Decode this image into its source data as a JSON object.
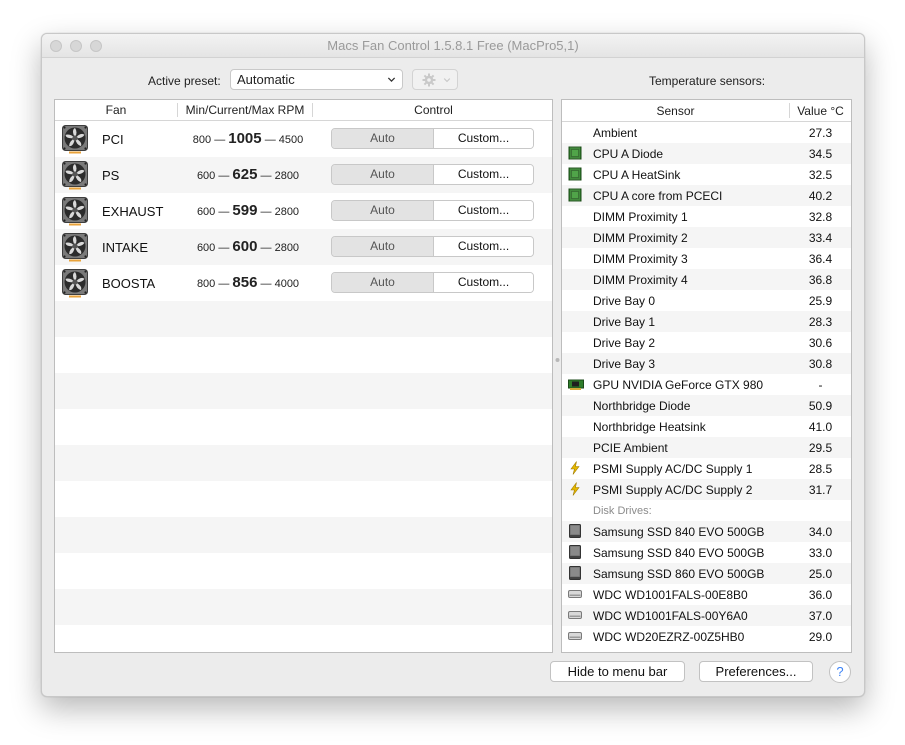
{
  "window": {
    "title": "Macs Fan Control 1.5.8.1 Free (MacPro5,1)"
  },
  "preset": {
    "label": "Active preset:",
    "value": "Automatic"
  },
  "temperature_title": "Temperature sensors:",
  "fan_table": {
    "headers": [
      "Fan",
      "Min/Current/Max RPM",
      "Control"
    ],
    "rows": [
      {
        "name": "PCI",
        "min": "800",
        "current": "1005",
        "max": "4500",
        "auto": "Auto",
        "custom": "Custom..."
      },
      {
        "name": "PS",
        "min": "600",
        "current": "625",
        "max": "2800",
        "auto": "Auto",
        "custom": "Custom..."
      },
      {
        "name": "EXHAUST",
        "min": "600",
        "current": "599",
        "max": "2800",
        "auto": "Auto",
        "custom": "Custom..."
      },
      {
        "name": "INTAKE",
        "min": "600",
        "current": "600",
        "max": "2800",
        "auto": "Auto",
        "custom": "Custom..."
      },
      {
        "name": "BOOSTA",
        "min": "800",
        "current": "856",
        "max": "4000",
        "auto": "Auto",
        "custom": "Custom..."
      }
    ],
    "separator": "—"
  },
  "sensor_table": {
    "headers": [
      "Sensor",
      "Value °C"
    ],
    "rows": [
      {
        "icon": "none",
        "name": "Ambient",
        "value": "27.3"
      },
      {
        "icon": "chip-icon",
        "name": "CPU A Diode",
        "value": "34.5"
      },
      {
        "icon": "chip-icon",
        "name": "CPU A HeatSink",
        "value": "32.5"
      },
      {
        "icon": "chip-icon",
        "name": "CPU A core from PCECI",
        "value": "40.2"
      },
      {
        "icon": "none",
        "name": "DIMM Proximity 1",
        "value": "32.8"
      },
      {
        "icon": "none",
        "name": "DIMM Proximity 2",
        "value": "33.4"
      },
      {
        "icon": "none",
        "name": "DIMM Proximity 3",
        "value": "36.4"
      },
      {
        "icon": "none",
        "name": "DIMM Proximity 4",
        "value": "36.8"
      },
      {
        "icon": "none",
        "name": "Drive Bay 0",
        "value": "25.9"
      },
      {
        "icon": "none",
        "name": "Drive Bay 1",
        "value": "28.3"
      },
      {
        "icon": "none",
        "name": "Drive Bay 2",
        "value": "30.6"
      },
      {
        "icon": "none",
        "name": "Drive Bay 3",
        "value": "30.8"
      },
      {
        "icon": "gpu-icon",
        "name": "GPU NVIDIA GeForce GTX 980",
        "value": "-"
      },
      {
        "icon": "none",
        "name": "Northbridge Diode",
        "value": "50.9"
      },
      {
        "icon": "none",
        "name": "Northbridge Heatsink",
        "value": "41.0"
      },
      {
        "icon": "none",
        "name": "PCIE Ambient",
        "value": "29.5"
      },
      {
        "icon": "bolt-icon",
        "name": "PSMI Supply AC/DC Supply 1",
        "value": "28.5"
      },
      {
        "icon": "bolt-icon",
        "name": "PSMI Supply AC/DC Supply 2",
        "value": "31.7"
      },
      {
        "section": "Disk Drives:"
      },
      {
        "icon": "ssd-icon",
        "name": "Samsung SSD 840 EVO 500GB",
        "value": "34.0"
      },
      {
        "icon": "ssd-icon",
        "name": "Samsung SSD 840 EVO 500GB",
        "value": "33.0"
      },
      {
        "icon": "ssd-icon",
        "name": "Samsung SSD 860 EVO 500GB",
        "value": "25.0"
      },
      {
        "icon": "hdd-icon",
        "name": "WDC WD1001FALS-00E8B0",
        "value": "36.0"
      },
      {
        "icon": "hdd-icon",
        "name": "WDC WD1001FALS-00Y6A0",
        "value": "37.0"
      },
      {
        "icon": "hdd-icon",
        "name": "WDC WD20EZRZ-00Z5HB0",
        "value": "29.0"
      }
    ]
  },
  "footer": {
    "hide_label": "Hide to menu bar",
    "prefs_label": "Preferences...",
    "help_label": "?"
  },
  "colors": {
    "chip": "#2f7d2a",
    "bolt": "#e6b800",
    "fan_accent": "#e8a23a",
    "help": "#3b82f6"
  }
}
